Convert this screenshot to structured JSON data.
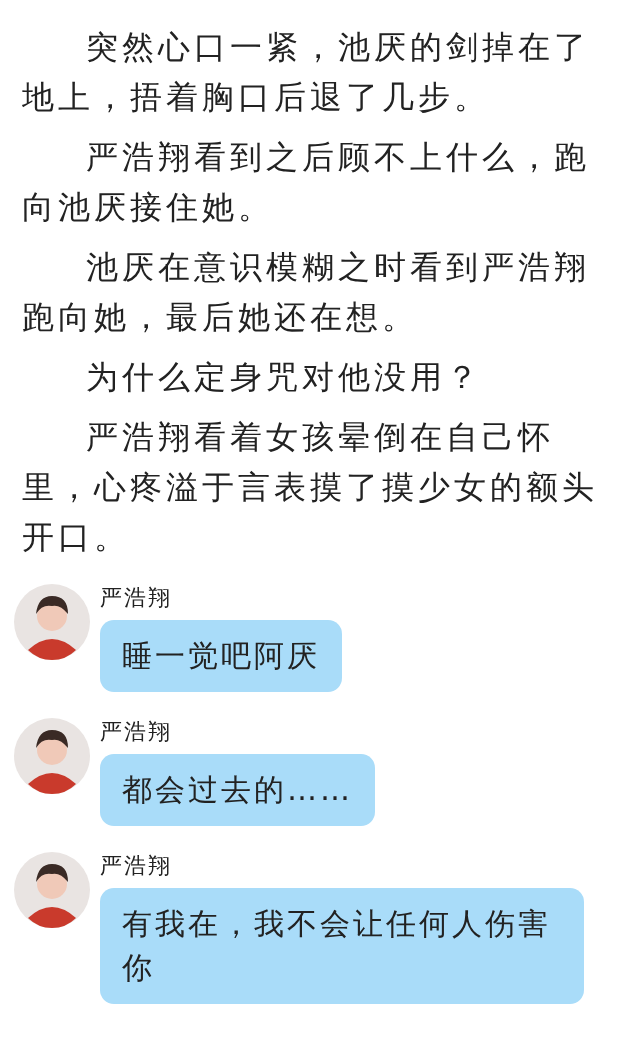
{
  "paragraphs": [
    "突然心口一紧，池厌的剑掉在了地上，捂着胸口后退了几步。",
    "严浩翔看到之后顾不上什么，跑向池厌接住她。",
    "池厌在意识模糊之时看到严浩翔跑向她，最后她还在想。",
    "为什么定身咒对他没用？",
    "严浩翔看着女孩晕倒在自己怀里，心疼溢于言表摸了摸少女的额头开口。"
  ],
  "messages": [
    {
      "sender": "严浩翔",
      "text": "睡一觉吧阿厌"
    },
    {
      "sender": "严浩翔",
      "text": "都会过去的……"
    },
    {
      "sender": "严浩翔",
      "text": "有我在，我不会让任何人伤害你"
    }
  ]
}
